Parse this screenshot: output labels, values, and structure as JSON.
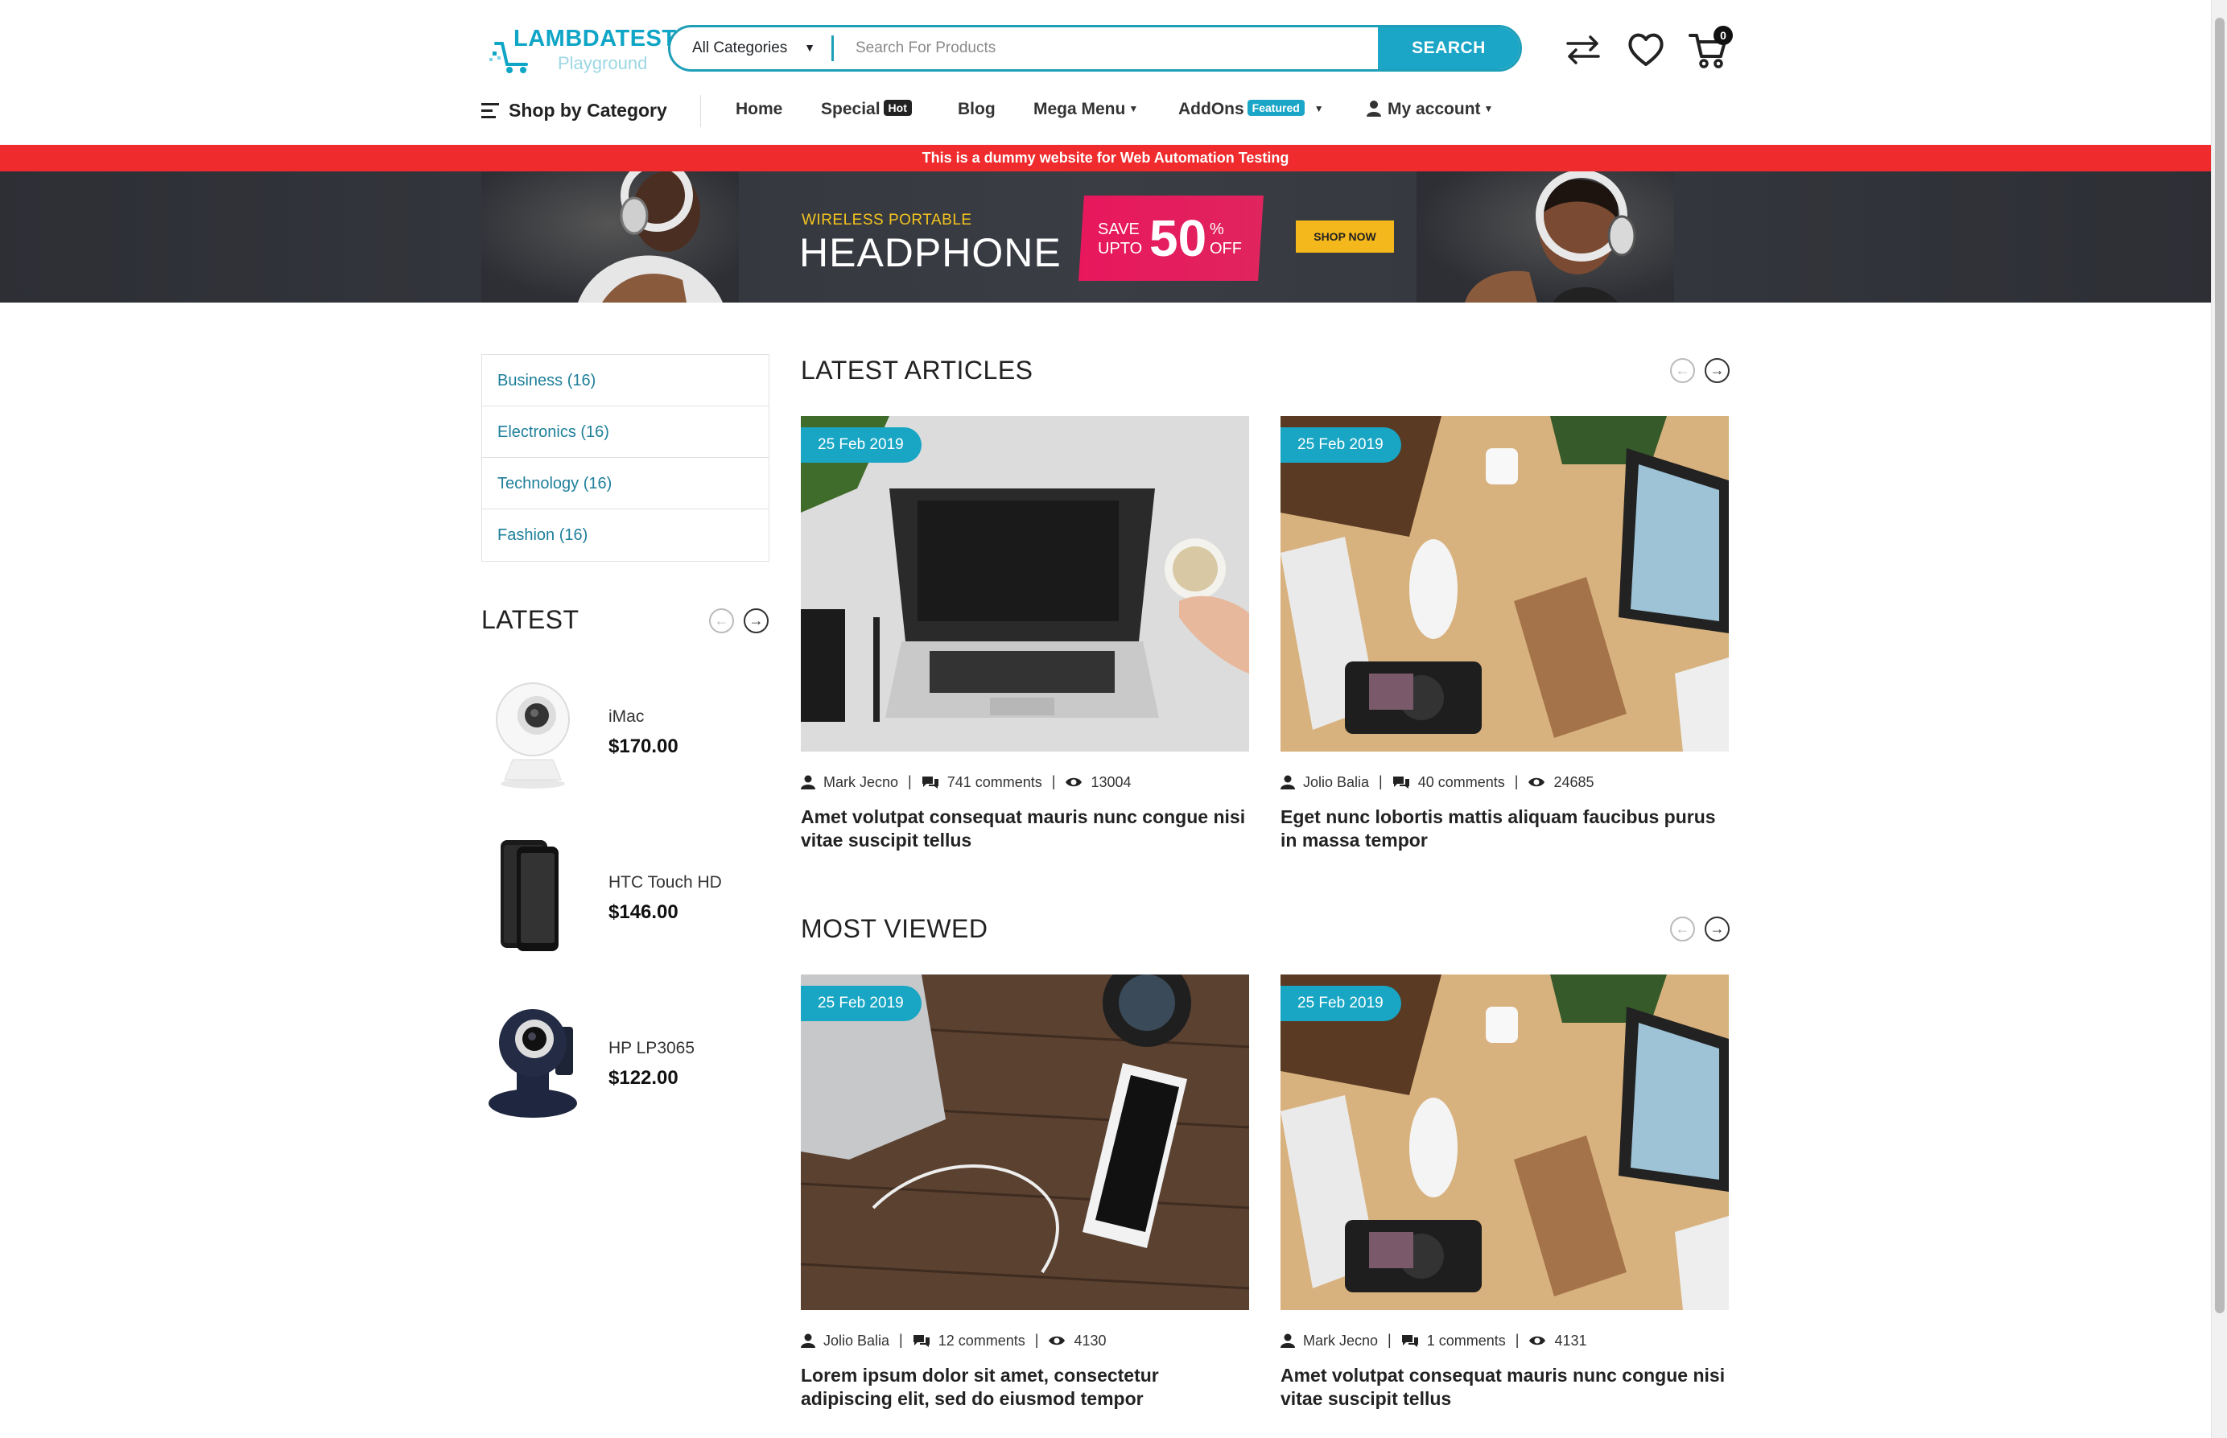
{
  "header": {
    "logo_main": "LAMBDATEST",
    "logo_sub": "Playground",
    "category_select": "All Categories",
    "search_placeholder": "Search For Products",
    "search_button": "SEARCH",
    "cart_count": "0"
  },
  "nav": {
    "shop_by_category": "Shop by Category",
    "items": [
      {
        "label": "Home"
      },
      {
        "label": "Special",
        "badge": "Hot"
      },
      {
        "label": "Blog"
      },
      {
        "label": "Mega Menu"
      },
      {
        "label": "AddOns",
        "badge": "Featured"
      },
      {
        "label": "My account"
      }
    ]
  },
  "notice": "This is a dummy website for Web Automation Testing",
  "banner": {
    "kicker": "WIRELESS PORTABLE",
    "headline": "HEADPHONE",
    "save_line1": "SAVE",
    "save_line2": "UPTO",
    "percent": "50",
    "percent_sign": "%",
    "off": "OFF",
    "cta": "SHOP NOW"
  },
  "categories": [
    "Business (16)",
    "Electronics (16)",
    "Technology (16)",
    "Fashion (16)"
  ],
  "latest": {
    "title": "LATEST",
    "products": [
      {
        "name": "iMac",
        "price": "$170.00"
      },
      {
        "name": "HTC Touch HD",
        "price": "$146.00"
      },
      {
        "name": "HP LP3065",
        "price": "$122.00"
      }
    ]
  },
  "latest_articles": {
    "title": "LATEST ARTICLES",
    "cards": [
      {
        "date": "25 Feb 2019",
        "author": "Mark Jecno",
        "comments": "741 comments",
        "views": "13004",
        "title": "Amet volutpat consequat mauris nunc congue nisi vitae suscipit tellus"
      },
      {
        "date": "25 Feb 2019",
        "author": "Jolio Balia",
        "comments": "40 comments",
        "views": "24685",
        "title": "Eget nunc lobortis mattis aliquam faucibus purus in massa tempor"
      }
    ]
  },
  "most_viewed": {
    "title": "MOST VIEWED",
    "cards": [
      {
        "date": "25 Feb 2019",
        "author": "Jolio Balia",
        "comments": "12 comments",
        "views": "4130",
        "title": "Lorem ipsum dolor sit amet, consectetur adipiscing elit, sed do eiusmod tempor"
      },
      {
        "date": "25 Feb 2019",
        "author": "Mark Jecno",
        "comments": "1 comments",
        "views": "4131",
        "title": "Amet volutpat consequat mauris nunc congue nisi vitae suscipit tellus"
      }
    ]
  },
  "colors": {
    "accent": "#1ba6c7",
    "notice_bg": "#ef2b2d",
    "banner_bg": "#2d2f35",
    "deal": "#e8175d",
    "cta": "#f5b81c"
  }
}
